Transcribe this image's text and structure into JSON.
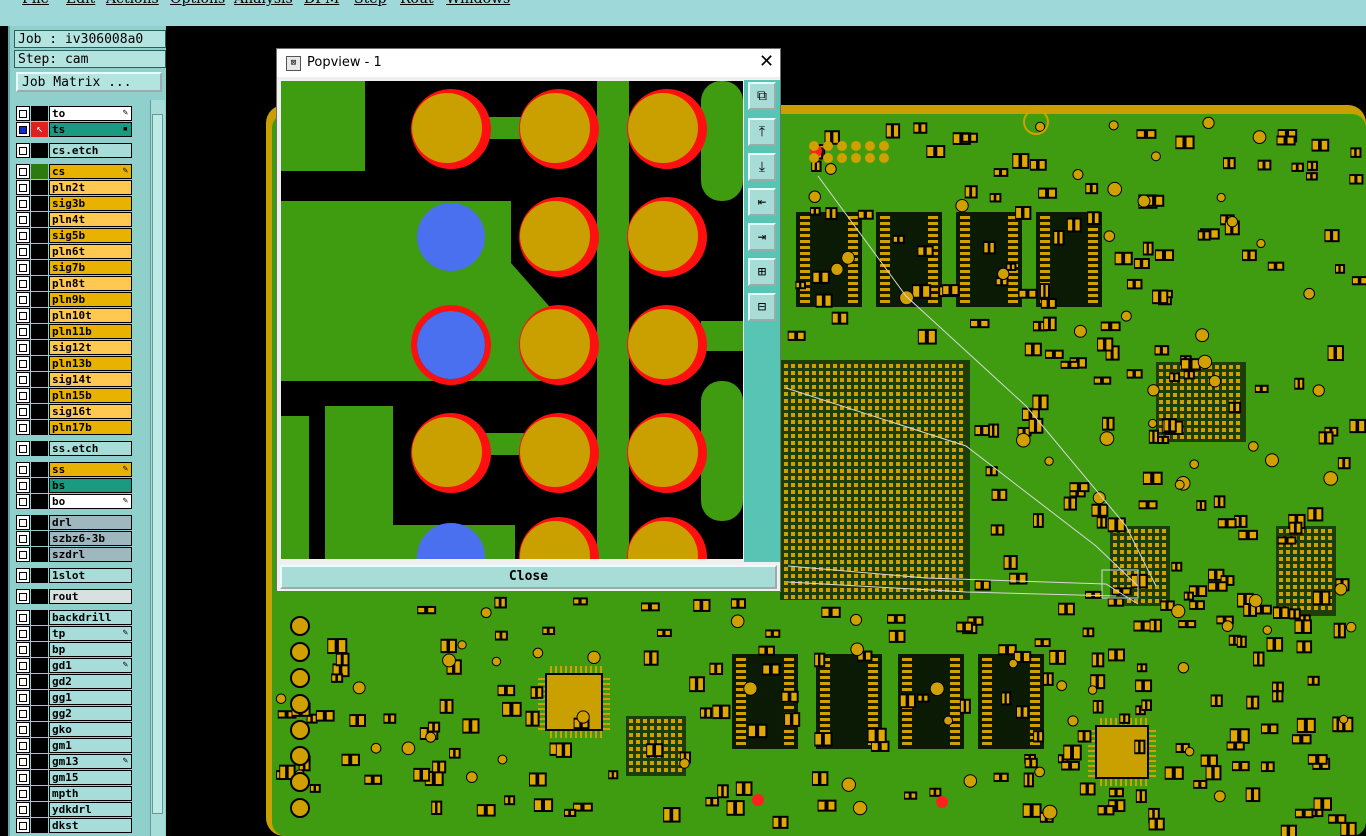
{
  "menu": [
    "File",
    "Edit",
    "Actions",
    "Options",
    "Analysis",
    "DFM",
    "Step",
    "Rout",
    "Windows"
  ],
  "info": {
    "job": "Job : iv306008a0",
    "step": "Step: cam",
    "job_matrix": "Job Matrix ..."
  },
  "layers": [
    {
      "name": "to",
      "color": "#ffffff",
      "edit": true
    },
    {
      "name": "ts",
      "color": "#1a9a80",
      "edit": false,
      "active": true
    },
    {
      "name": "cs.etch",
      "color": "#a8dcd8",
      "edit": false
    },
    {
      "name": "cs",
      "color": "#e8b300",
      "edit": true
    },
    {
      "name": "pln2t",
      "color": "#ffc850",
      "edit": false
    },
    {
      "name": "sig3b",
      "color": "#e8b300",
      "edit": false
    },
    {
      "name": "pln4t",
      "color": "#ffc850",
      "edit": false
    },
    {
      "name": "sig5b",
      "color": "#e8b300",
      "edit": false
    },
    {
      "name": "pln6t",
      "color": "#ffc850",
      "edit": false
    },
    {
      "name": "sig7b",
      "color": "#e8b300",
      "edit": false
    },
    {
      "name": "pln8t",
      "color": "#ffc850",
      "edit": false
    },
    {
      "name": "pln9b",
      "color": "#e8b300",
      "edit": false
    },
    {
      "name": "pln10t",
      "color": "#ffc850",
      "edit": false
    },
    {
      "name": "pln11b",
      "color": "#e8b300",
      "edit": false
    },
    {
      "name": "sig12t",
      "color": "#ffc850",
      "edit": false
    },
    {
      "name": "pln13b",
      "color": "#e8b300",
      "edit": false
    },
    {
      "name": "sig14t",
      "color": "#ffc850",
      "edit": false
    },
    {
      "name": "pln15b",
      "color": "#e8b300",
      "edit": false
    },
    {
      "name": "sig16t",
      "color": "#ffc850",
      "edit": false
    },
    {
      "name": "pln17b",
      "color": "#e8b300",
      "edit": false
    },
    {
      "name": "ss.etch",
      "color": "#a8dcd8",
      "edit": false
    },
    {
      "name": "ss",
      "color": "#e8b300",
      "edit": true
    },
    {
      "name": "bs",
      "color": "#1a9a80",
      "edit": false
    },
    {
      "name": "bo",
      "color": "#ffffff",
      "edit": true
    },
    {
      "name": "drl",
      "color": "#9fb8c0",
      "edit": false
    },
    {
      "name": "szbz6-3b",
      "color": "#9fb8c0",
      "edit": false
    },
    {
      "name": "szdrl",
      "color": "#9fb8c0",
      "edit": false
    },
    {
      "name": "1slot",
      "color": "#a8dcd8",
      "edit": false
    },
    {
      "name": "rout",
      "color": "#d8e0e0",
      "edit": false
    },
    {
      "name": "backdrill",
      "color": "#a8dcd8",
      "edit": false
    },
    {
      "name": "tp",
      "color": "#a8dcd8",
      "edit": true
    },
    {
      "name": "bp",
      "color": "#a8dcd8",
      "edit": false
    },
    {
      "name": "gd1",
      "color": "#a8dcd8",
      "edit": true
    },
    {
      "name": "gd2",
      "color": "#a8dcd8",
      "edit": false
    },
    {
      "name": "gg1",
      "color": "#a8dcd8",
      "edit": false
    },
    {
      "name": "gg2",
      "color": "#a8dcd8",
      "edit": false
    },
    {
      "name": "gko",
      "color": "#a8dcd8",
      "edit": false
    },
    {
      "name": "gm1",
      "color": "#a8dcd8",
      "edit": false
    },
    {
      "name": "gm13",
      "color": "#a8dcd8",
      "edit": true
    },
    {
      "name": "gm15",
      "color": "#a8dcd8",
      "edit": false
    },
    {
      "name": "mpth",
      "color": "#a8dcd8",
      "edit": false
    },
    {
      "name": "ydkdrl",
      "color": "#a8dcd8",
      "edit": false
    },
    {
      "name": "dkst",
      "color": "#a8dcd8",
      "edit": false
    }
  ],
  "popup": {
    "title": "Popview - 1",
    "close_label": "Close"
  },
  "colors": {
    "board_green": "#3f9b10",
    "copper": "#c9a000",
    "pad_ring": "#ff1010",
    "via_blue": "#4a70f0",
    "panel": "#8fd0cc"
  },
  "icons": [
    "zoom-fit-icon",
    "pan-up-icon",
    "pan-down-icon",
    "pan-left-icon",
    "pan-right-icon",
    "zoom-in-icon",
    "zoom-out-icon"
  ]
}
